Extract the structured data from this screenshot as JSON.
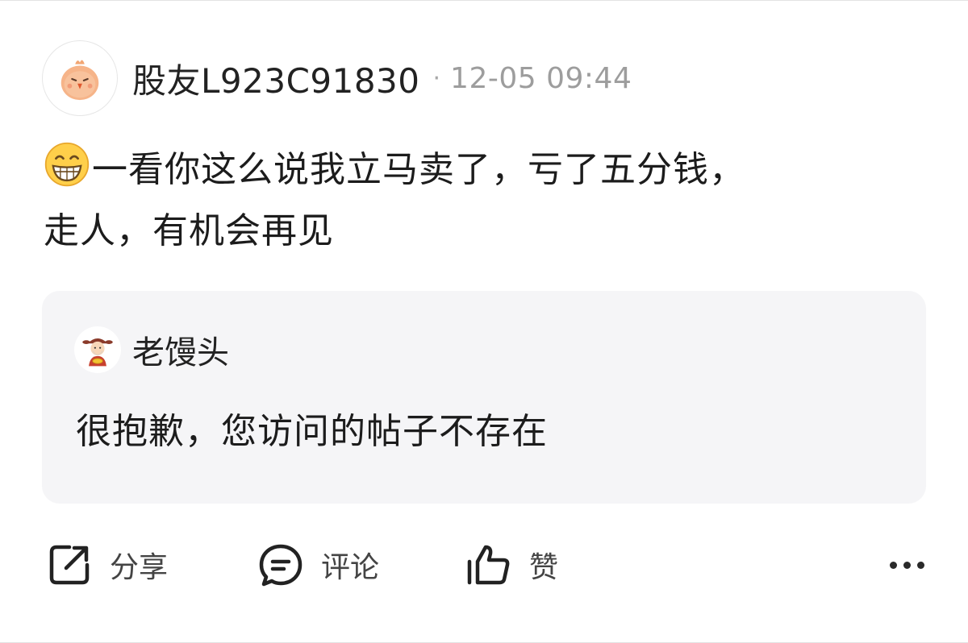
{
  "post": {
    "author": "股友L923C91830",
    "separator": "·",
    "timestamp": "12-05 09:44",
    "avatar_icon": "chick-avatar-icon",
    "emoji": "grinning-face-emoji",
    "text_line1": "一看你这么说我立马卖了，亏了五分钱，",
    "text_line2": "走人，有机会再见"
  },
  "quote": {
    "author": "老馒头",
    "avatar_icon": "fortune-god-avatar-icon",
    "text": "很抱歉，您访问的帖子不存在"
  },
  "actions": {
    "share_label": "分享",
    "comment_label": "评论",
    "like_label": "赞",
    "share_icon": "share-icon",
    "comment_icon": "comment-icon",
    "like_icon": "thumbs-up-icon",
    "more_icon": "more-icon"
  },
  "colors": {
    "card_background": "#f5f5f7",
    "timestamp": "#9d9d9d",
    "avatar_orange": "#f0a070"
  }
}
